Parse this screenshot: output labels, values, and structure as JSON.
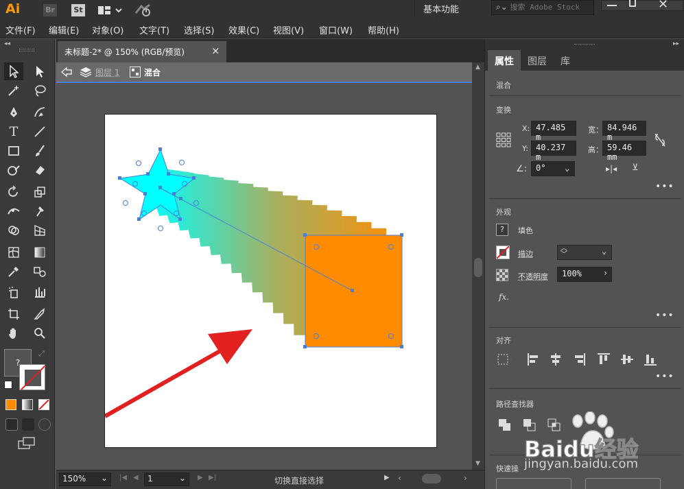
{
  "app": {
    "logo": "Ai",
    "badge_br": "Br",
    "badge_st": "St",
    "workspace": "基本功能",
    "search_placeholder": "搜索 Adobe Stock"
  },
  "menu": [
    "文件(F)",
    "编辑(E)",
    "对象(O)",
    "文字(T)",
    "选择(S)",
    "效果(C)",
    "视图(V)",
    "窗口(W)",
    "帮助(H)"
  ],
  "document": {
    "tab_title": "未标题-2* @ 150% (RGB/预览)",
    "tab_close": "×",
    "breadcrumb_layer": "图层 1",
    "breadcrumb_group": "混合"
  },
  "toolbar": {
    "fill_unknown": "?"
  },
  "status": {
    "zoom": "150%",
    "artboard_number": "1",
    "tool_message": "切换直接选择"
  },
  "panel": {
    "tabs": [
      "属性",
      "图层",
      "库"
    ],
    "object_type": "混合",
    "transform_title": "变换",
    "x_label": "X:",
    "x_value": "47.485 m",
    "y_label": "Y:",
    "y_value": "40.237 m",
    "w_label": "宽：",
    "w_value": "84.946 m",
    "h_label": "高：",
    "h_value": "59.46 mm",
    "angle_value": "0°",
    "appearance_title": "外观",
    "fill_label": "填色",
    "stroke_label": "描边",
    "opacity_label": "不透明度",
    "opacity_value": "100%",
    "fx_label": "fx.",
    "align_title": "对齐",
    "pathfinder_title": "路径查找器",
    "quick_actions_title": "快速操",
    "more": "•••"
  },
  "watermark": {
    "brand": "Baidu经验",
    "url": "jingyan.baidu.com"
  },
  "colors": {
    "orange": "#ff8c00",
    "cyan": "#00ffff",
    "selection_blue": "#4a7fd8",
    "arrow_red": "#e32020",
    "ai_orange": "#ff9a00"
  }
}
